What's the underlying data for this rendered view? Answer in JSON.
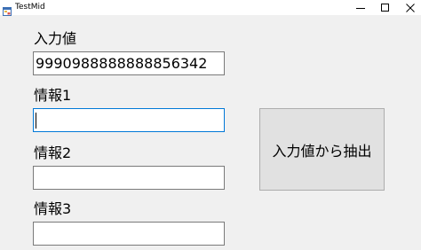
{
  "window": {
    "title": "TestMid",
    "icons": {
      "app": "app-icon",
      "minimize": "minimize-icon",
      "maximize": "maximize-icon",
      "close": "close-icon"
    }
  },
  "form": {
    "input_label": "入力値",
    "input_value": "9990988888888856342",
    "info1_label": "情報1",
    "info1_value": "",
    "info2_label": "情報2",
    "info2_value": "",
    "info3_label": "情報3",
    "info3_value": "",
    "extract_button_label": "入力値から抽出"
  },
  "colors": {
    "window_bg": "#f0f0f0",
    "focus_border": "#0078d7",
    "textbox_border": "#7a7a7a",
    "button_bg": "#e1e1e1"
  }
}
